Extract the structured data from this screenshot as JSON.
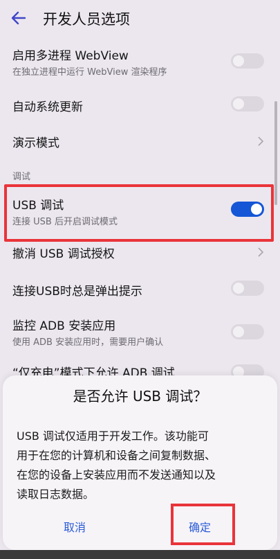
{
  "header": {
    "title": "开发人员选项"
  },
  "rows": {
    "multiprocess": {
      "title": "启用多进程 WebView",
      "subtitle": "在独立进程中运行 WebView 渲染程序",
      "on": false
    },
    "auto_update": {
      "title": "自动系统更新",
      "on": false
    },
    "demo_mode": {
      "title": "演示模式"
    },
    "section_debug": "调试",
    "usb_debug": {
      "title": "USB 调试",
      "subtitle": "连接 USB 后开启调试模式",
      "on": true
    },
    "revoke": {
      "title": "撤消 USB 调试授权"
    },
    "usb_prompt": {
      "title": "连接USB时总是弹出提示",
      "on": false
    },
    "adb_monitor": {
      "title": "监控 ADB 安装应用",
      "subtitle": "使用 ADB 安装应用时，需要用户确认",
      "on": false
    },
    "charge_only": {
      "title": "“仅充电”模式下允许 ADB 调试"
    }
  },
  "dialog": {
    "title": "是否允许 USB 调试？",
    "body_lines": [
      "USB 调试仅适用于开发工作。该功能可",
      "用于在您的计算机和设备之间复制数据、",
      "在您的设备上安装应用而不发送通知以及",
      "读取日志数据。"
    ],
    "cancel": "取消",
    "confirm": "确定"
  },
  "colors": {
    "accent": "#1456d6",
    "highlight": "#e9343a",
    "background": "#ece7ef"
  }
}
